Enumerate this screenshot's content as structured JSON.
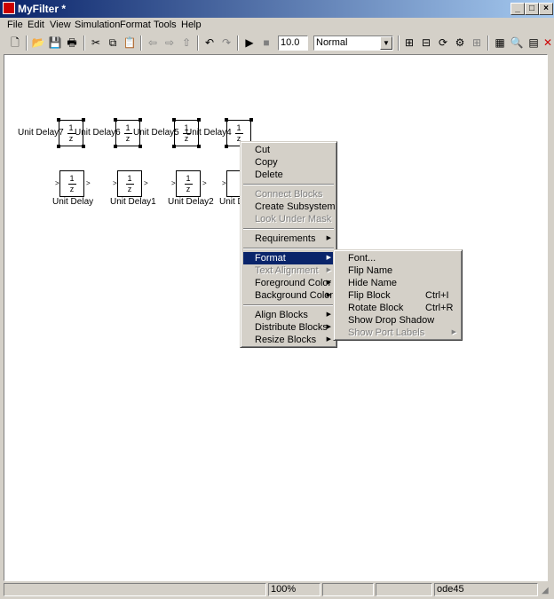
{
  "window": {
    "title": "MyFilter *"
  },
  "menubar": [
    "File",
    "Edit",
    "View",
    "Simulation",
    "Format",
    "Tools",
    "Help"
  ],
  "toolbar": {
    "stop_time": "10.0",
    "sim_mode": "Normal"
  },
  "blocks": {
    "unit_delay": "Unit Delay",
    "unit_delay1": "Unit Delay1",
    "unit_delay2": "Unit Delay2",
    "unit_delay3": "Unit D",
    "unit_delay4": "Unit Delay4",
    "unit_delay5": "Unit Delay5",
    "unit_delay6": "Unit Delay6",
    "unit_delay7": "Unit Delay7",
    "numerator": "1",
    "denominator": "z"
  },
  "context_menu": {
    "cut": "Cut",
    "copy": "Copy",
    "delete": "Delete",
    "connect_blocks": "Connect Blocks",
    "create_subsystem": "Create Subsystem",
    "look_under_mask": "Look Under Mask",
    "requirements": "Requirements",
    "format": "Format",
    "text_alignment": "Text Alignment",
    "foreground_color": "Foreground Color",
    "background_color": "Background Color",
    "align_blocks": "Align Blocks",
    "distribute_blocks": "Distribute Blocks",
    "resize_blocks": "Resize Blocks"
  },
  "format_submenu": {
    "font": "Font...",
    "flip_name": "Flip Name",
    "hide_name": "Hide Name",
    "flip_block": "Flip Block",
    "flip_block_shortcut": "Ctrl+I",
    "rotate_block": "Rotate Block",
    "rotate_block_shortcut": "Ctrl+R",
    "show_drop_shadow": "Show Drop Shadow",
    "show_port_labels": "Show Port Labels"
  },
  "statusbar": {
    "zoom": "100%",
    "solver": "ode45"
  }
}
